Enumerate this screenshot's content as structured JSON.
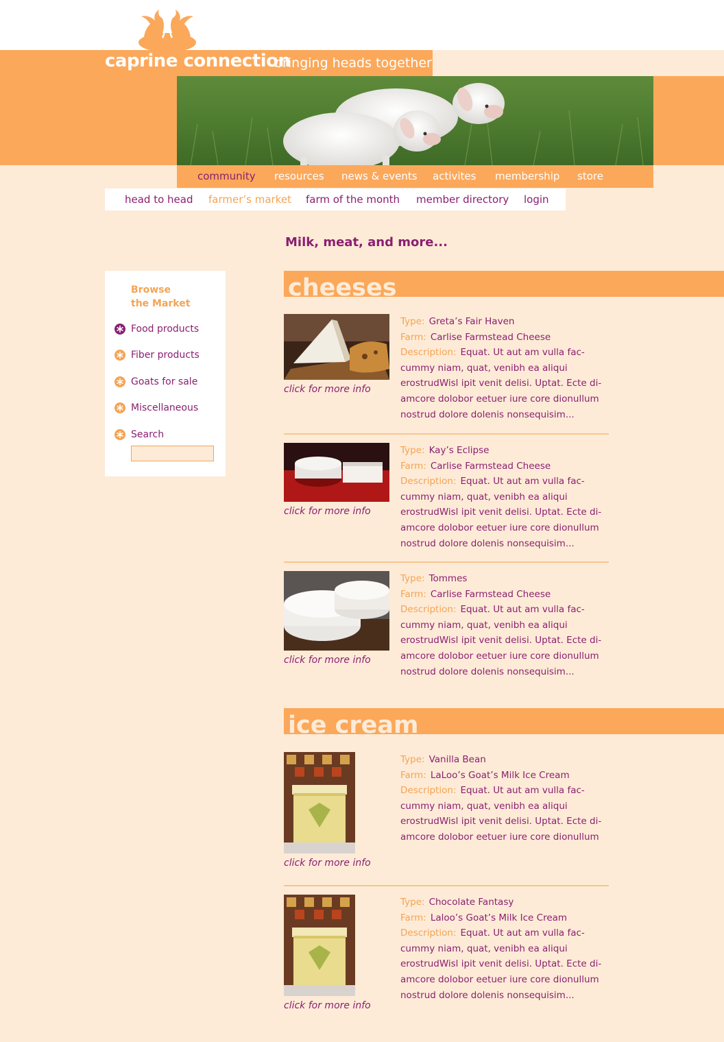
{
  "header": {
    "site_name": "caprine connection",
    "tagline": "bringing heads together",
    "logo_icon": "two-goats-icon"
  },
  "colors": {
    "orange": "#fba85a",
    "light_orange": "#f5a353",
    "purple": "#8a1f70",
    "cream": "#fdebd7"
  },
  "main_nav": [
    {
      "label": "community",
      "active": true
    },
    {
      "label": "resources"
    },
    {
      "label": "news & events"
    },
    {
      "label": "activites"
    },
    {
      "label": "membership"
    },
    {
      "label": "store"
    }
  ],
  "sub_nav": [
    {
      "label": "head to head"
    },
    {
      "label": "farmer’s market",
      "active": true
    },
    {
      "label": "farm of the month"
    },
    {
      "label": "member directory"
    },
    {
      "label": "login"
    }
  ],
  "page_heading": "Milk, meat, and more...",
  "sidebar": {
    "title_line1": "Browse",
    "title_line2": "the Market",
    "items": [
      {
        "label": "Food products",
        "icon": "asterisk-circle-icon",
        "active": true
      },
      {
        "label": "Fiber products",
        "icon": "asterisk-circle-icon"
      },
      {
        "label": "Goats for sale",
        "icon": "asterisk-circle-icon"
      },
      {
        "label": "Miscellaneous",
        "icon": "asterisk-circle-icon"
      },
      {
        "label": "Search",
        "icon": "asterisk-circle-icon"
      }
    ],
    "search_value": ""
  },
  "labels": {
    "type": "Type:",
    "farm": "Farm:",
    "description": "Description:",
    "more_info": "click for more info"
  },
  "sections": [
    {
      "title": "cheeses",
      "products": [
        {
          "type": "Greta’s Fair Haven",
          "farm": "Carlise Farmstead Cheese",
          "desc_first": "Equat. Ut aut am vulla fac-",
          "desc_rest": "cummy niam, quat, venibh ea aliqui erostrudWisl ipit venit delisi. Uptat. Ecte di-amcore dolobor eetuer iure core dionullum nostrud dolore dolenis nonsequisim..."
        },
        {
          "type": "Kay’s Eclipse",
          "farm": "Carlise Farmstead Cheese",
          "desc_first": "Equat. Ut aut am vulla fac-",
          "desc_rest": "cummy niam, quat, venibh ea aliqui erostrudWisl ipit venit delisi. Uptat. Ecte di-amcore dolobor eetuer iure core dionullum nostrud dolore dolenis nonsequisim..."
        },
        {
          "type": "Tommes",
          "farm": "Carlise Farmstead Cheese",
          "desc_first": "Equat. Ut aut am vulla fac-",
          "desc_rest": "cummy niam, quat, venibh ea aliqui erostrudWisl ipit venit delisi. Uptat. Ecte di-amcore dolobor eetuer iure core dionullum nostrud dolore dolenis nonsequisim..."
        }
      ]
    },
    {
      "title": "ice cream",
      "products": [
        {
          "type": "Vanilla Bean",
          "farm": "LaLoo’s Goat’s Milk Ice Cream",
          "desc_first": "Equat. Ut aut am vulla fac-",
          "desc_rest": "cummy niam, quat, venibh ea aliqui erostrudWisl ipit venit delisi. Uptat. Ecte di-amcore dolobor eetuer iure core dionullum"
        },
        {
          "type": "Chocolate Fantasy",
          "farm": "Laloo’s Goat’s Milk Ice Cream",
          "desc_first": "Equat. Ut aut am vulla fac-",
          "desc_rest": "cummy niam, quat, venibh ea aliqui erostrudWisl ipit venit delisi. Uptat. Ecte di-amcore dolobor eetuer iure core dionullum nostrud dolore dolenis nonsequisim..."
        }
      ]
    }
  ]
}
